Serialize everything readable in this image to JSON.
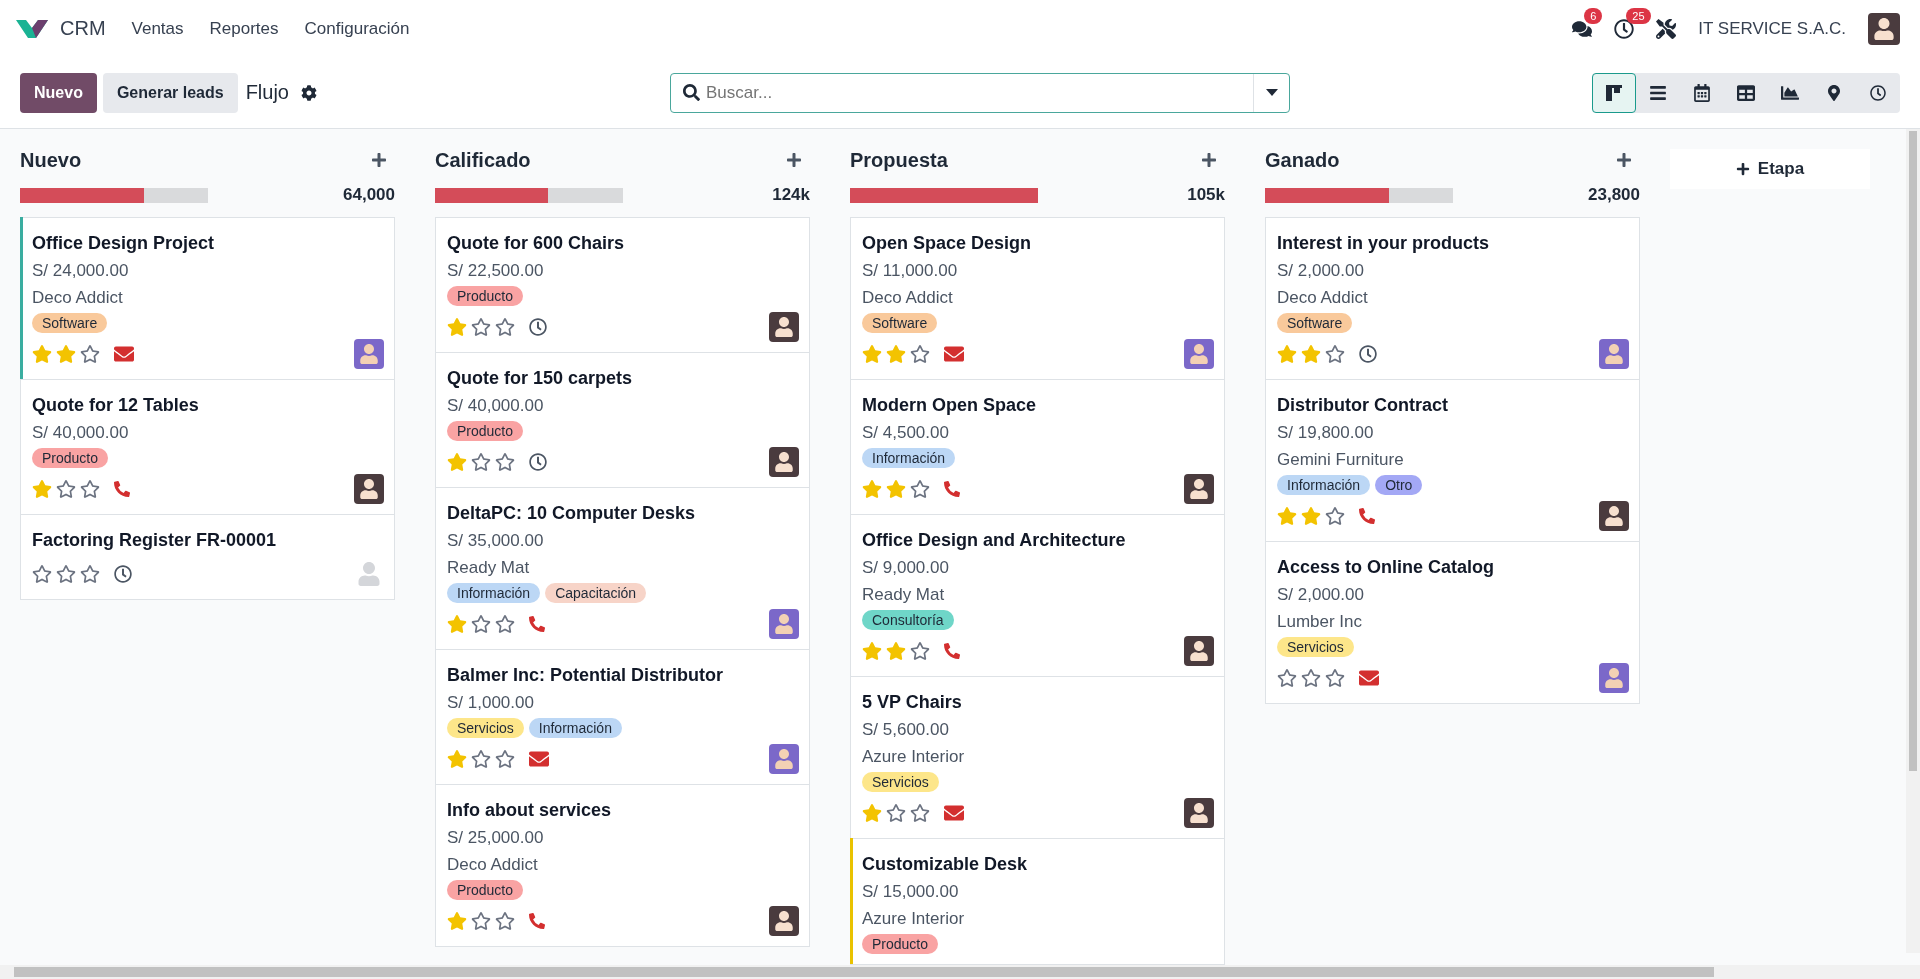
{
  "navbar": {
    "app": "CRM",
    "menu": [
      "Ventas",
      "Reportes",
      "Configuración"
    ],
    "messages_badge": "6",
    "activities_badge": "25",
    "company": "IT SERVICE S.A.C."
  },
  "control_panel": {
    "new_button": "Nuevo",
    "generate_button": "Generar leads",
    "title": "Flujo",
    "search": {
      "placeholder": "Buscar..."
    },
    "views": [
      {
        "kind": "kanban",
        "selected": true
      },
      {
        "kind": "list",
        "selected": false
      },
      {
        "kind": "calendar",
        "selected": false
      },
      {
        "kind": "pivot",
        "selected": false
      },
      {
        "kind": "graph",
        "selected": false
      },
      {
        "kind": "map",
        "selected": false
      },
      {
        "kind": "activity",
        "selected": false
      }
    ]
  },
  "columns": [
    {
      "title": "Nuevo",
      "total": "64,000",
      "level": 0.66,
      "cards": [
        {
          "title": "Office Design Project",
          "amount": "S/ 24,000.00",
          "partner": "Deco Addict",
          "color": "#3aada0",
          "tags": [
            {
              "label": "Software",
              "color": "#f9c99b"
            }
          ],
          "stars": 2,
          "activity": {
            "kind": "email"
          },
          "avatar": {
            "kind": "purple"
          }
        },
        {
          "title": "Quote for 12 Tables",
          "amount": "S/ 40,000.00",
          "tags": [
            {
              "label": "Producto",
              "color": "#f9a3a3"
            }
          ],
          "stars": 1,
          "activity": {
            "kind": "phone"
          },
          "avatar": {
            "kind": "dark"
          }
        },
        {
          "title": "Factoring Register FR-00001",
          "stars": 0,
          "activity": {
            "kind": "clock"
          },
          "avatar": {
            "kind": "placeholder"
          }
        }
      ]
    },
    {
      "title": "Calificado",
      "total": "124k",
      "level": 0.6,
      "cards": [
        {
          "title": "Quote for 600 Chairs",
          "amount": "S/ 22,500.00",
          "tags": [
            {
              "label": "Producto",
              "color": "#f9a3a3"
            }
          ],
          "stars": 1,
          "activity": {
            "kind": "clock"
          },
          "avatar": {
            "kind": "dark"
          }
        },
        {
          "title": "Quote for 150 carpets",
          "amount": "S/ 40,000.00",
          "tags": [
            {
              "label": "Producto",
              "color": "#f9a3a3"
            }
          ],
          "stars": 1,
          "activity": {
            "kind": "clock"
          },
          "avatar": {
            "kind": "dark"
          }
        },
        {
          "title": "DeltaPC: 10 Computer Desks",
          "amount": "S/ 35,000.00",
          "partner": "Ready Mat",
          "tags": [
            {
              "label": "Información",
              "color": "#bcd7f5"
            },
            {
              "label": "Capacitación",
              "color": "#f7d4c8"
            }
          ],
          "stars": 1,
          "activity": {
            "kind": "phone"
          },
          "avatar": {
            "kind": "purple"
          }
        },
        {
          "title": "Balmer Inc: Potential Distributor",
          "amount": "S/ 1,000.00",
          "tags": [
            {
              "label": "Servicios",
              "color": "#fde68a"
            },
            {
              "label": "Información",
              "color": "#bcd7f5"
            }
          ],
          "stars": 1,
          "activity": {
            "kind": "email"
          },
          "avatar": {
            "kind": "purple"
          }
        },
        {
          "title": "Info about services",
          "amount": "S/ 25,000.00",
          "partner": "Deco Addict",
          "tags": [
            {
              "label": "Producto",
              "color": "#f9a3a3"
            }
          ],
          "stars": 1,
          "activity": {
            "kind": "phone"
          },
          "avatar": {
            "kind": "dark"
          }
        }
      ]
    },
    {
      "title": "Propuesta",
      "total": "105k",
      "level": 1,
      "cards": [
        {
          "title": "Open Space Design",
          "amount": "S/ 11,000.00",
          "partner": "Deco Addict",
          "tags": [
            {
              "label": "Software",
              "color": "#f9c99b"
            }
          ],
          "stars": 2,
          "activity": {
            "kind": "email"
          },
          "avatar": {
            "kind": "purple"
          }
        },
        {
          "title": "Modern Open Space",
          "amount": "S/ 4,500.00",
          "tags": [
            {
              "label": "Información",
              "color": "#bcd7f5"
            }
          ],
          "stars": 2,
          "activity": {
            "kind": "phone"
          },
          "avatar": {
            "kind": "dark"
          }
        },
        {
          "title": "Office Design and Architecture",
          "amount": "S/ 9,000.00",
          "partner": "Ready Mat",
          "tags": [
            {
              "label": "Consultoría",
              "color": "#6fd6c8"
            }
          ],
          "stars": 2,
          "activity": {
            "kind": "phone"
          },
          "avatar": {
            "kind": "dark"
          }
        },
        {
          "title": "5 VP Chairs",
          "amount": "S/ 5,600.00",
          "partner": "Azure Interior",
          "tags": [
            {
              "label": "Servicios",
              "color": "#fde68a"
            }
          ],
          "stars": 1,
          "activity": {
            "kind": "email"
          },
          "avatar": {
            "kind": "dark"
          }
        },
        {
          "title": "Customizable Desk",
          "amount": "S/ 15,000.00",
          "partner": "Azure Interior",
          "color": "#e9c200",
          "tags": [
            {
              "label": "Producto",
              "color": "#f9a3a3"
            }
          ]
        }
      ]
    },
    {
      "title": "Ganado",
      "total": "23,800",
      "level": 0.66,
      "cards": [
        {
          "title": "Interest in your products",
          "amount": "S/ 2,000.00",
          "partner": "Deco Addict",
          "tags": [
            {
              "label": "Software",
              "color": "#f9c99b"
            }
          ],
          "stars": 2,
          "activity": {
            "kind": "clock"
          },
          "avatar": {
            "kind": "purple"
          }
        },
        {
          "title": "Distributor Contract",
          "amount": "S/ 19,800.00",
          "partner": "Gemini Furniture",
          "tags": [
            {
              "label": "Información",
              "color": "#bcd7f5"
            },
            {
              "label": "Otro",
              "color": "#a3a8f5"
            }
          ],
          "stars": 2,
          "activity": {
            "kind": "phone"
          },
          "avatar": {
            "kind": "dark"
          }
        },
        {
          "title": "Access to Online Catalog",
          "amount": "S/ 2,000.00",
          "partner": "Lumber Inc",
          "tags": [
            {
              "label": "Servicios",
              "color": "#fde68a"
            }
          ],
          "stars": 0,
          "activity": {
            "kind": "email"
          },
          "avatar": {
            "kind": "purple"
          }
        }
      ]
    }
  ],
  "add_stage": "Etapa"
}
